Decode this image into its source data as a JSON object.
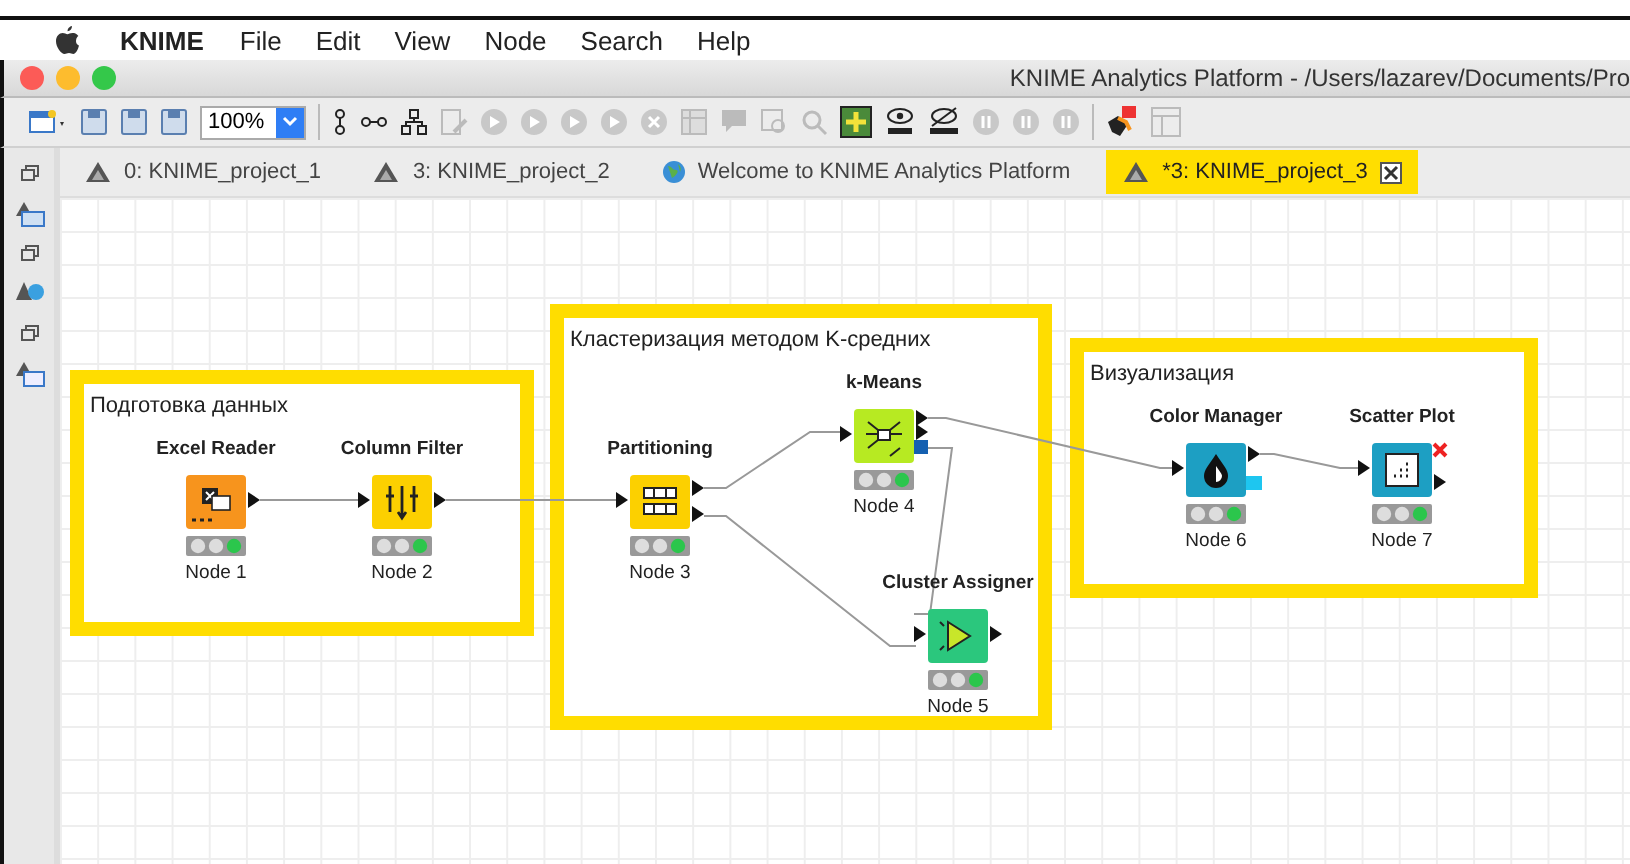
{
  "menu_bar": {
    "app_name": "KNIME",
    "items": [
      "File",
      "Edit",
      "View",
      "Node",
      "Search",
      "Help"
    ]
  },
  "window": {
    "title": "KNIME Analytics Platform - /Users/lazarev/Documents/Pro"
  },
  "toolbar": {
    "zoom": "100%"
  },
  "tabs": [
    {
      "label": "0: KNIME_project_1",
      "kind": "workflow",
      "selected": false
    },
    {
      "label": "3: KNIME_project_2",
      "kind": "workflow",
      "selected": false
    },
    {
      "label": "Welcome to KNIME Analytics Platform",
      "kind": "welcome",
      "selected": false
    },
    {
      "label": "*3: KNIME_project_3",
      "kind": "workflow",
      "selected": true
    }
  ],
  "annotations": [
    {
      "title": "Подготовка данных"
    },
    {
      "title": "Кластеризация методом K-средних"
    },
    {
      "title": "Визуализация"
    }
  ],
  "nodes": [
    {
      "name": "Excel Reader",
      "id_label": "Node 1",
      "kind": "excel",
      "executed": true
    },
    {
      "name": "Column Filter",
      "id_label": "Node 2",
      "kind": "filter",
      "executed": true
    },
    {
      "name": "Partitioning",
      "id_label": "Node 3",
      "kind": "partition",
      "executed": true
    },
    {
      "name": "k-Means",
      "id_label": "Node 4",
      "kind": "kmeans",
      "executed": true
    },
    {
      "name": "Cluster Assigner",
      "id_label": "Node 5",
      "kind": "assigner",
      "executed": true
    },
    {
      "name": "Color Manager",
      "id_label": "Node 6",
      "kind": "color",
      "executed": true
    },
    {
      "name": "Scatter Plot",
      "id_label": "Node 7",
      "kind": "scatter",
      "executed": true
    }
  ]
}
